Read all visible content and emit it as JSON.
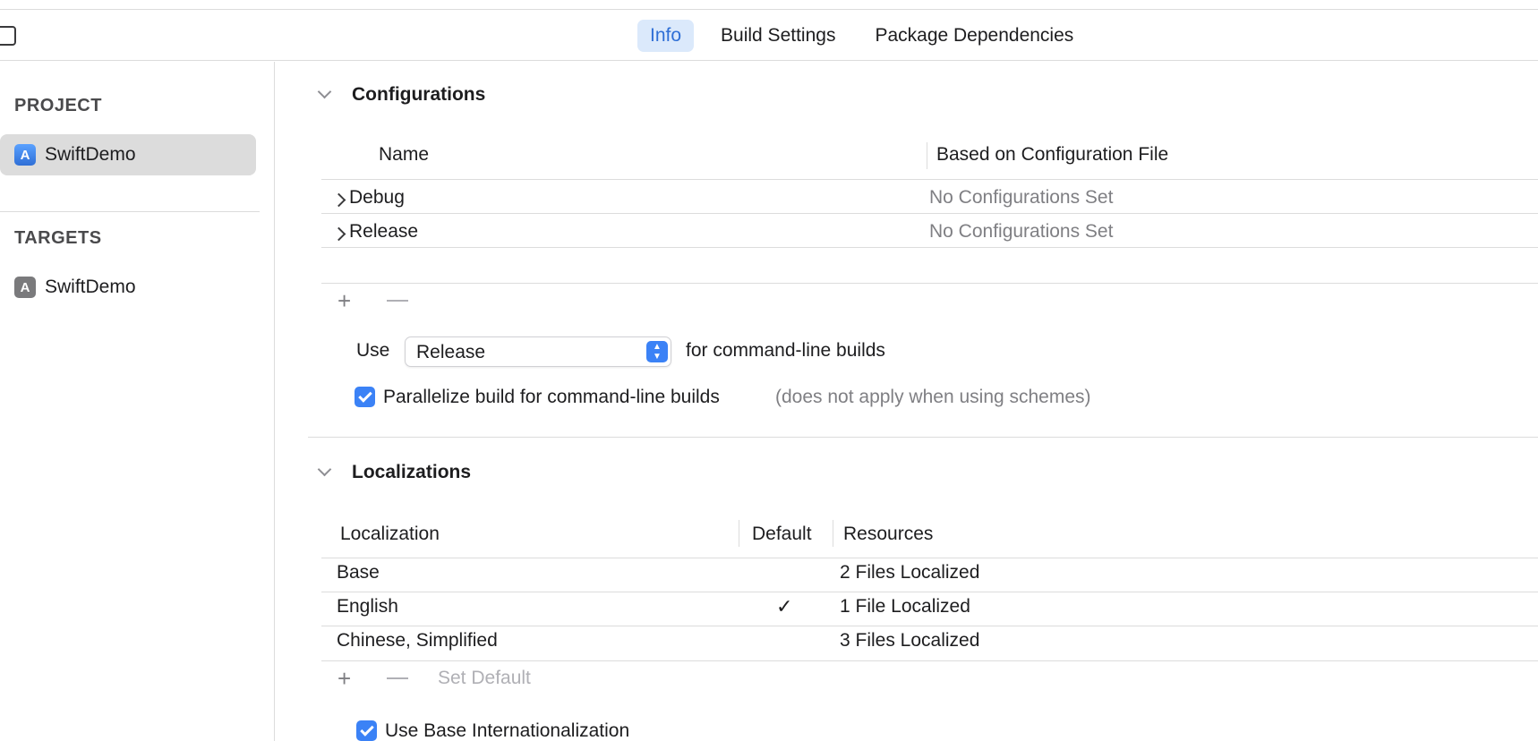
{
  "tabs": [
    {
      "label": "Info",
      "active": true
    },
    {
      "label": "Build Settings",
      "active": false
    },
    {
      "label": "Package Dependencies",
      "active": false
    }
  ],
  "sidebar": {
    "project_heading": "PROJECT",
    "project_item": "SwiftDemo",
    "targets_heading": "TARGETS",
    "target_item": "SwiftDemo"
  },
  "configurations": {
    "title": "Configurations",
    "columns": [
      "Name",
      "Based on Configuration File"
    ],
    "rows": [
      {
        "name": "Debug",
        "file": "No Configurations Set"
      },
      {
        "name": "Release",
        "file": "No Configurations Set"
      }
    ],
    "add_glyph": "+",
    "use_label": "Use",
    "selected_config": "Release",
    "command_line_suffix": "for command-line builds",
    "parallelize_label": "Parallelize build for command-line builds",
    "parallelize_note": "(does not apply when using schemes)"
  },
  "localizations": {
    "title": "Localizations",
    "columns": [
      "Localization",
      "Default",
      "Resources"
    ],
    "rows": [
      {
        "name": "Base",
        "default": "",
        "resources": "2 Files Localized"
      },
      {
        "name": "English",
        "default": "✓",
        "resources": "1 File Localized"
      },
      {
        "name": "Chinese, Simplified",
        "default": "",
        "resources": "3 Files Localized"
      }
    ],
    "add_glyph": "+",
    "set_default_label": "Set Default",
    "base_intl_label": "Use Base Internationalization"
  },
  "colors": {
    "accent": "#3b82f6",
    "tab_active_bg": "#dbe9fb",
    "selection_bg": "#dcdcdc",
    "muted_text": "#7f7f83"
  }
}
